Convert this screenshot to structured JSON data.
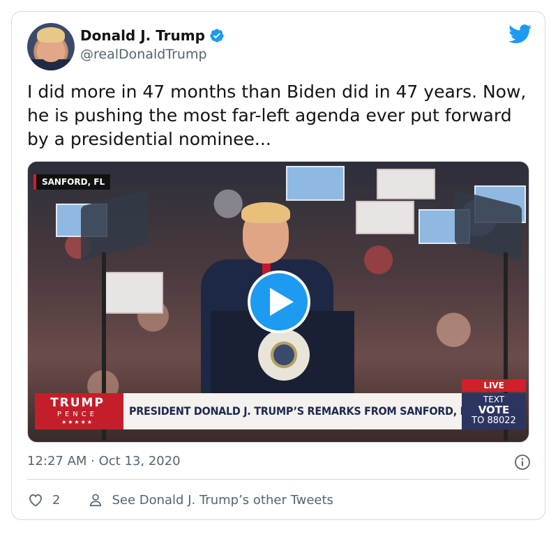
{
  "author": {
    "name": "Donald J. Trump",
    "handle": "@realDonaldTrump",
    "verified": true
  },
  "tweet": {
    "text": "I did more in 47 months than Biden did in 47 years. Now, he is pushing the most far-left agenda ever put forward by a presidential nominee...",
    "timestamp": "12:27 AM · Oct 13, 2020",
    "likes": "2",
    "other_tweets_label": "See Donald J. Trump’s other Tweets"
  },
  "video": {
    "location_tag": "SANFORD, FL",
    "brand_line1": "TRUMP",
    "brand_line2": "PENCE",
    "brand_stars": "★★★★★",
    "banner": "PRESIDENT DONALD J. TRUMP’S REMARKS FROM SANFORD, FL",
    "live_label": "LIVE",
    "cta_line1": "TEXT",
    "cta_line2": "VOTE",
    "cta_line3": "TO 88022"
  },
  "colors": {
    "twitter_blue": "#1d9bf0",
    "text_primary": "#0f1419",
    "text_secondary": "#536471",
    "border": "#cfd9de",
    "broadcast_red": "#c41e2a",
    "broadcast_navy": "#2c3562"
  },
  "icons": {
    "verified": "verified-badge-icon",
    "brand": "twitter-bird-icon",
    "play": "play-icon",
    "info": "info-icon",
    "like": "heart-icon",
    "profile": "person-icon"
  }
}
